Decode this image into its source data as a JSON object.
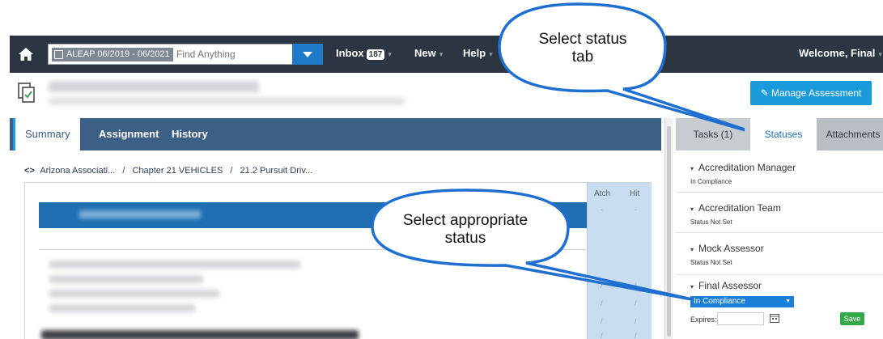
{
  "topbar": {
    "breadcrumb_chip": "ALEAP 06/2019 - 06/2021",
    "search_placeholder": "Find Anything",
    "inbox_label": "Inbox",
    "inbox_count": "187",
    "new_label": "New",
    "help_label": "Help",
    "welcome_label": "Welcome, Final"
  },
  "header": {
    "manage_button": "Manage Assessment"
  },
  "main": {
    "tabs": [
      {
        "label": "Summary"
      },
      {
        "label": "Assignment"
      },
      {
        "label": "History"
      }
    ],
    "breadcrumb": {
      "part1": "Arizona Associati...",
      "sep": "/",
      "part2": "Chapter 21 VEHICLES",
      "part3": "21.2 Pursuit Driv..."
    },
    "columns": {
      "atch": "Atch",
      "hit": "Hit"
    }
  },
  "right_panel": {
    "tabs": [
      {
        "label": "Tasks (1)"
      },
      {
        "label": "Statuses"
      },
      {
        "label": "Attachments"
      }
    ],
    "statuses": [
      {
        "role": "Accreditation Manager",
        "value": "In Compliance"
      },
      {
        "role": "Accreditation Team",
        "value": "Status Not Set"
      },
      {
        "role": "Mock Assessor",
        "value": "Status Not Set"
      },
      {
        "role": "Final Assessor",
        "value": "In Compliance"
      }
    ],
    "expires_label": "Expires:",
    "save_label": "Save"
  },
  "callouts": {
    "status_tab": {
      "line1": "Select status",
      "line2": "tab"
    },
    "appropriate_status": {
      "line1": "Select appropriate",
      "line2": "status"
    }
  },
  "colors": {
    "nav_bg": "#2c3643",
    "tab_bar": "#3c5f86",
    "accent_blue": "#1a9ad9",
    "save_green": "#33a94a",
    "callout_border": "#1f6fd1"
  }
}
